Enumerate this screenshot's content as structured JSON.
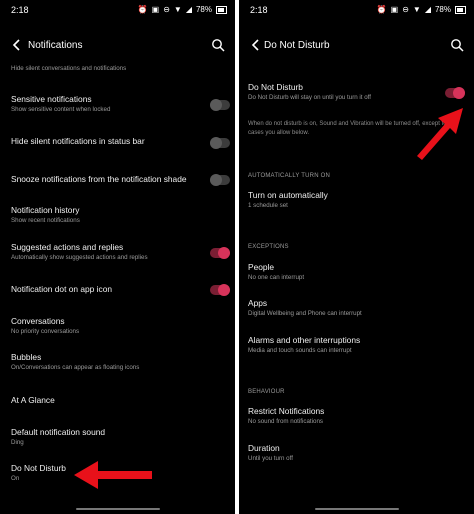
{
  "status": {
    "time": "2:18",
    "battery": "78%"
  },
  "left": {
    "title": "Notifications",
    "partial_sub": "Hide silent conversations and notifications",
    "items": [
      {
        "label": "Sensitive notifications",
        "sub": "Show sensitive content when locked",
        "toggle": "off"
      },
      {
        "label": "Hide silent notifications in status bar",
        "sub": "",
        "toggle": "off"
      },
      {
        "label": "Snooze notifications from the notification shade",
        "sub": "",
        "toggle": "off"
      },
      {
        "label": "Notification history",
        "sub": "Show recent notifications"
      },
      {
        "label": "Suggested actions and replies",
        "sub": "Automatically show suggested actions and replies",
        "toggle": "on"
      },
      {
        "label": "Notification dot on app icon",
        "sub": "",
        "toggle": "on"
      },
      {
        "label": "Conversations",
        "sub": "No priority conversations"
      },
      {
        "label": "Bubbles",
        "sub": "On/Conversations can appear as floating icons"
      },
      {
        "label": "At A Glance",
        "sub": ""
      },
      {
        "label": "Default notification sound",
        "sub": "Ding"
      },
      {
        "label": "Do Not Disturb",
        "sub": "On"
      }
    ]
  },
  "right": {
    "title": "Do Not Disturb",
    "dnd_label": "Do Not Disturb",
    "dnd_sub": "Do Not Disturb will stay on until you turn it off",
    "dnd_toggle": "on",
    "note": "When do not disturb is on, Sound and Vibration will be turned off, except for the cases you allow below.",
    "section_auto": "AUTOMATICALLY TURN ON",
    "auto_item": {
      "label": "Turn on automatically",
      "sub": "1 schedule set"
    },
    "section_exceptions": "EXCEPTIONS",
    "exceptions": [
      {
        "label": "People",
        "sub": "No one can interrupt"
      },
      {
        "label": "Apps",
        "sub": "Digital Wellbeing and Phone can interrupt"
      },
      {
        "label": "Alarms and other interruptions",
        "sub": "Media and touch sounds can interrupt"
      }
    ],
    "section_behaviour": "BEHAVIOUR",
    "behaviour": [
      {
        "label": "Restrict Notifications",
        "sub": "No sound from notifications"
      },
      {
        "label": "Duration",
        "sub": "Until you turn off"
      }
    ]
  },
  "colors": {
    "accent": "#d6335a",
    "arrow": "#e8111a",
    "background": "#000000"
  }
}
